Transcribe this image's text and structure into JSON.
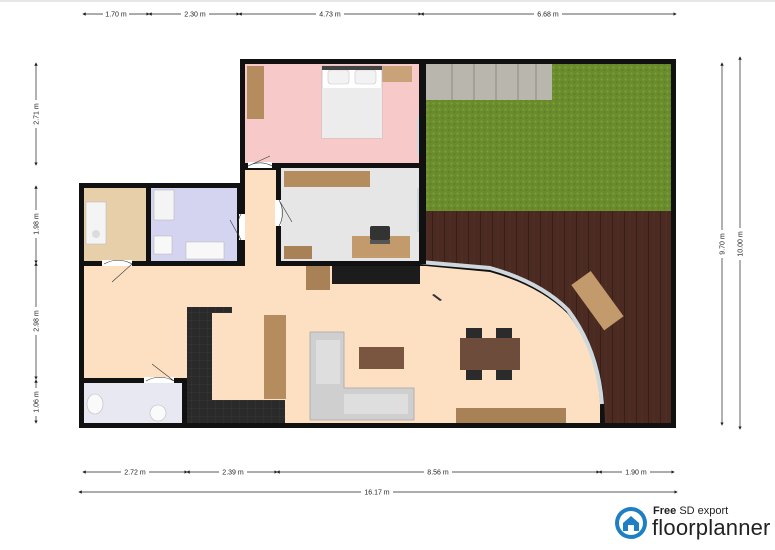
{
  "dimensions": {
    "top": [
      "1.70 m",
      "2.30 m",
      "4.73 m",
      "6.68 m"
    ],
    "bottom": [
      "2.72 m",
      "2.39 m",
      "8.56 m",
      "1.90 m"
    ],
    "total_width": "16.17 m",
    "left": [
      "2.71 m",
      "1.98 m",
      "2.98 m",
      "1.06 m"
    ],
    "right_inner": "9.70 m",
    "right_outer": "10.00 m"
  },
  "branding": {
    "export_prefix": "Free",
    "export_label": "SD export",
    "name": "floorplanner",
    "icon": "floorplanner-house-icon",
    "icon_color": "#1f7fc4"
  },
  "colors": {
    "wall": "#111111",
    "bedroom": "#f8c9c9",
    "living": "#fde0c2",
    "bath": "#d4d4f0",
    "kitchenette": "#e6cfa9",
    "office": "#e6e6e6",
    "toilet": "#e8e8f2",
    "grass": "#6a8c2c",
    "deck": "#4a2a21"
  }
}
